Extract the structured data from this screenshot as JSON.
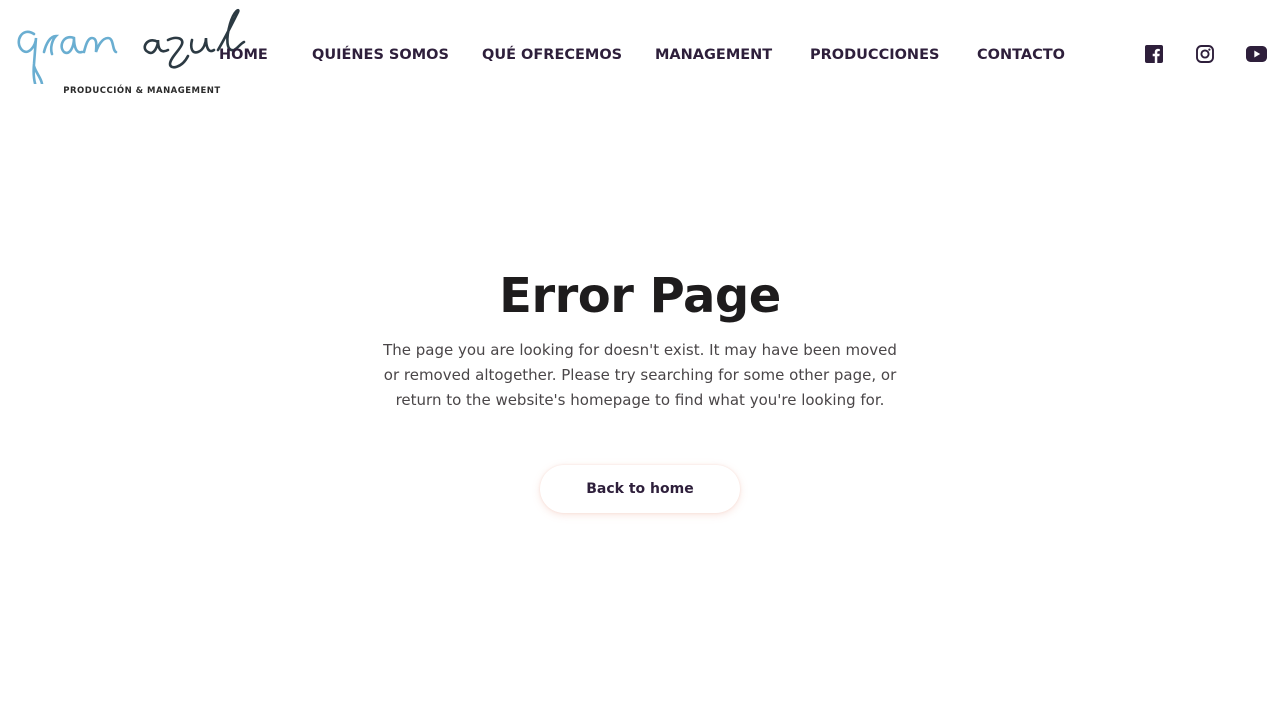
{
  "logo": {
    "wordmark_left": "gran",
    "wordmark_right": "azul",
    "tagline": "PRODUCCIÓN & MANAGEMENT",
    "colors": {
      "blue": "#6aaed1",
      "dark": "#2c3a43"
    }
  },
  "nav": {
    "items": [
      {
        "label": "HOME"
      },
      {
        "label": "QUIÉNES SOMOS"
      },
      {
        "label": "QUÉ OFRECEMOS"
      },
      {
        "label": "MANAGEMENT"
      },
      {
        "label": "PRODUCCIONES"
      },
      {
        "label": "CONTACTO"
      }
    ]
  },
  "social": {
    "icons": [
      "facebook-icon",
      "instagram-icon",
      "youtube-icon"
    ],
    "color": "#2e1f3b"
  },
  "error": {
    "title": "Error Page",
    "message": "The page you are looking for doesn't exist. It may have been moved or removed altogether. Please try searching for some other page, or return to the website's homepage to find what you're looking for.",
    "button_label": "Back to home"
  }
}
